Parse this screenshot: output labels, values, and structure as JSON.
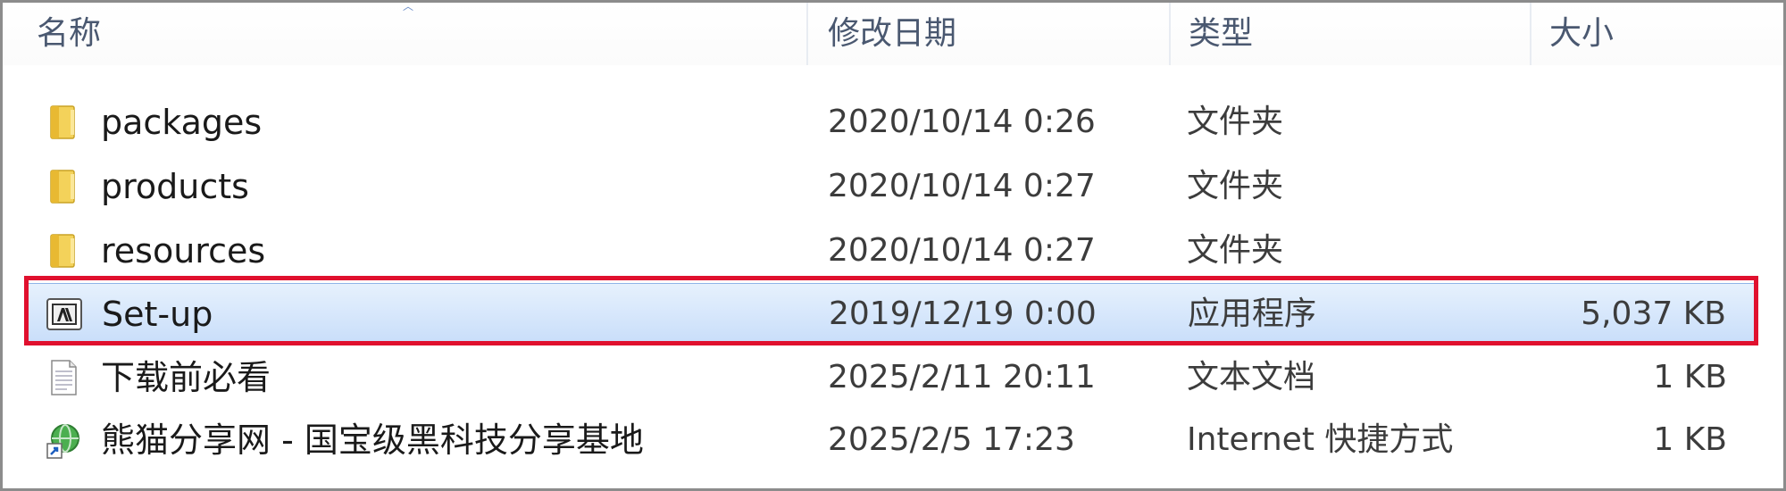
{
  "columns": {
    "name": "名称",
    "date": "修改日期",
    "type": "类型",
    "size": "大小"
  },
  "files": [
    {
      "name": "packages",
      "date": "2020/10/14 0:26",
      "type": "文件夹",
      "size": "",
      "icon": "folder-icon",
      "selected": false
    },
    {
      "name": "products",
      "date": "2020/10/14 0:27",
      "type": "文件夹",
      "size": "",
      "icon": "folder-icon",
      "selected": false
    },
    {
      "name": "resources",
      "date": "2020/10/14 0:27",
      "type": "文件夹",
      "size": "",
      "icon": "folder-icon",
      "selected": false
    },
    {
      "name": "Set-up",
      "date": "2019/12/19 0:00",
      "type": "应用程序",
      "size": "5,037 KB",
      "icon": "adobe-app-icon",
      "selected": true
    },
    {
      "name": "下载前必看",
      "date": "2025/2/11 20:11",
      "type": "文本文档",
      "size": "1 KB",
      "icon": "text-document-icon",
      "selected": false
    },
    {
      "name": "熊猫分享网 - 国宝级黑科技分享基地",
      "date": "2025/2/5 17:23",
      "type": "Internet 快捷方式",
      "size": "1 KB",
      "icon": "internet-shortcut-icon",
      "selected": false
    }
  ],
  "colors": {
    "highlight_border": "#e0102e",
    "selection_bg": "#c9defa",
    "header_text": "#4a5870"
  }
}
